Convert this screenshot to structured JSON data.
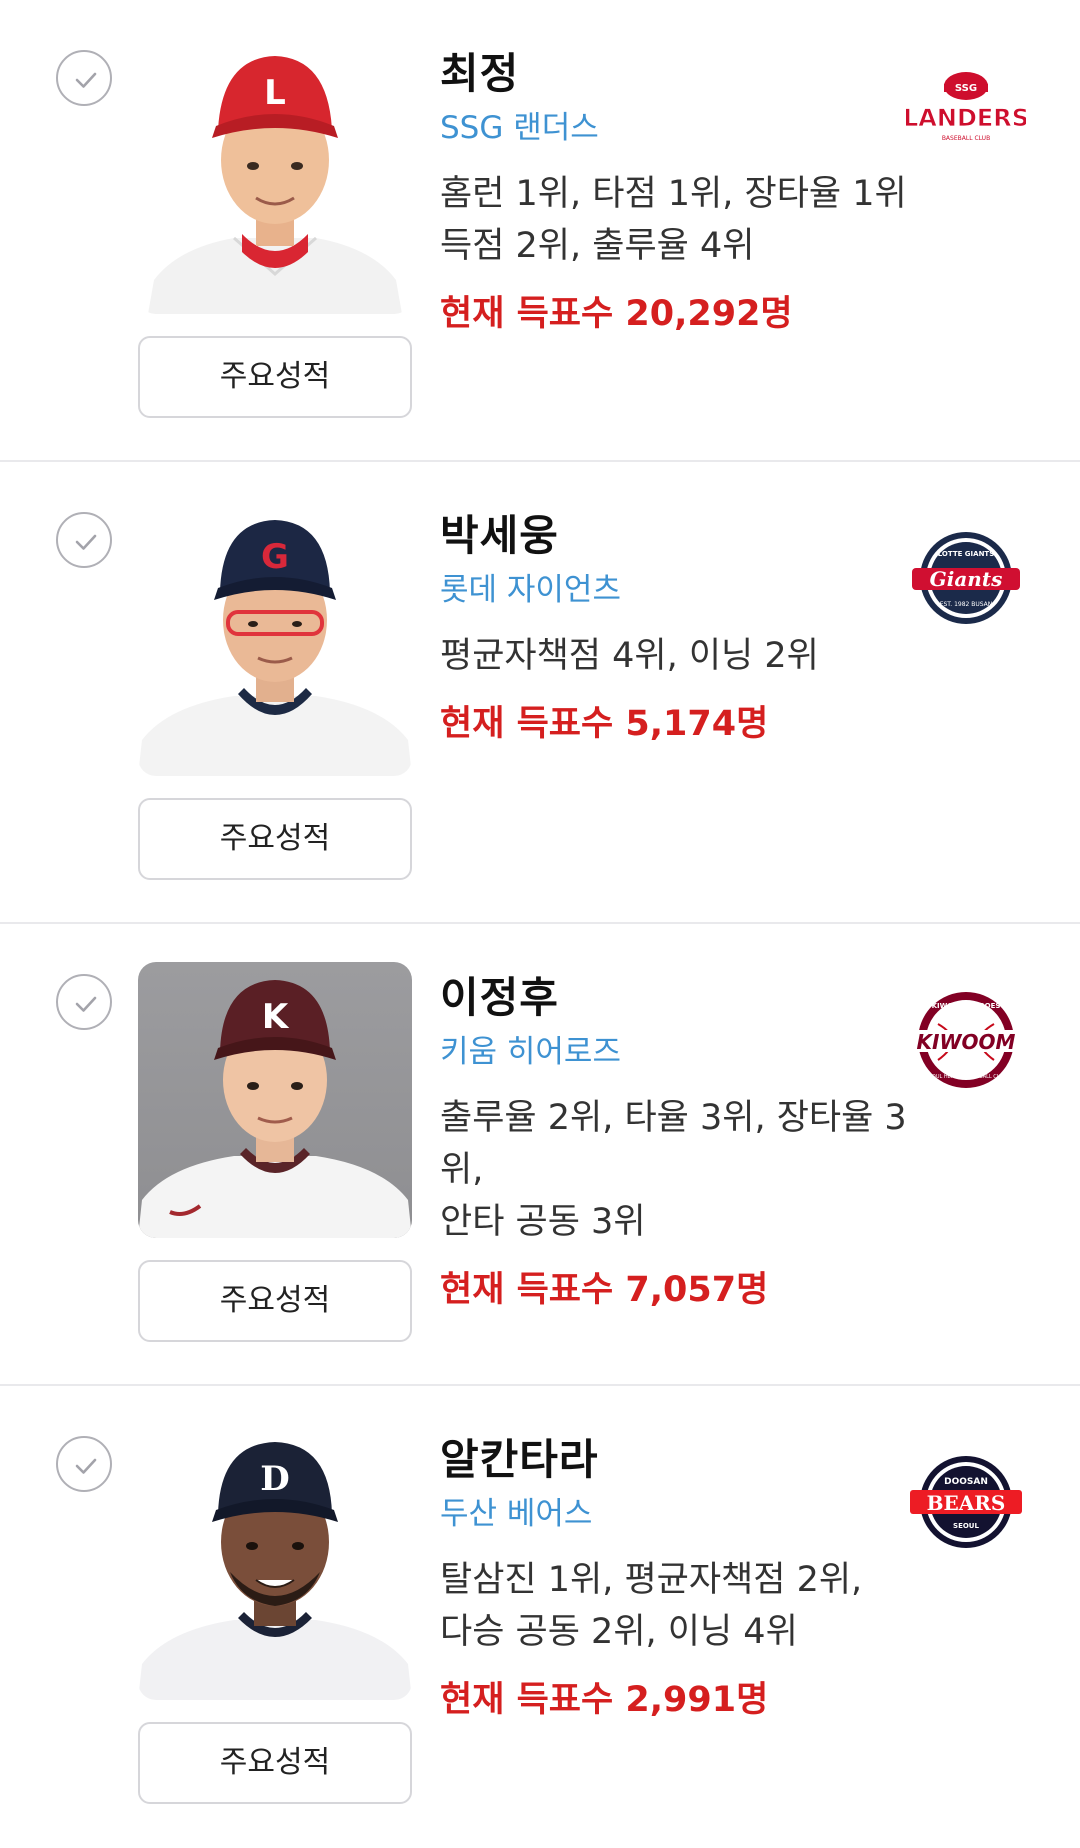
{
  "players": [
    {
      "name": "최정",
      "team": "SSG 랜더스",
      "records": "홈런 1위, 타점 1위, 장타율 1위\n득점 2위, 출루율 4위",
      "votes": "현재 득표수 20,292명",
      "stats_button": "주요성적",
      "logo": {
        "icon": "ssg-landers-logo",
        "top": "SSG",
        "main": "LANDERS",
        "sub": "BASEBALL CLUB",
        "color": "#ce0e2d"
      },
      "cap_color": "#d7262e",
      "cap_letter": "L"
    },
    {
      "name": "박세웅",
      "team": "롯데 자이언츠",
      "records": "평균자책점 4위, 이닝 2위",
      "votes": "현재 득표수 5,174명",
      "stats_button": "주요성적",
      "logo": {
        "icon": "lotte-giants-logo",
        "top": "LOTTE GIANTS",
        "main": "Giants",
        "sub": "EST. 1982 BUSAN",
        "color": "#d00f31"
      },
      "cap_color": "#1c2744",
      "cap_letter": "G"
    },
    {
      "name": "이정후",
      "team": "키움 히어로즈",
      "records": "출루율 2위, 타율 3위, 장타율 3위,\n안타 공동 3위",
      "votes": "현재 득표수 7,057명",
      "stats_button": "주요성적",
      "logo": {
        "icon": "kiwoom-heroes-logo",
        "top": "KIWOOM HEROES",
        "main": "KIWOOM",
        "sub": "SEOUL HEROES BASEBALL CLUB",
        "color": "#820024"
      },
      "cap_color": "#5a1f25",
      "cap_letter": "K"
    },
    {
      "name": "알칸타라",
      "team": "두산 베어스",
      "records": "탈삼진 1위, 평균자책점 2위,\n다승 공동 2위, 이닝 4위",
      "votes": "현재 득표수 2,991명",
      "stats_button": "주요성적",
      "logo": {
        "icon": "doosan-bears-logo",
        "top": "DOOSAN",
        "main": "BEARS",
        "sub": "SEOUL",
        "color": "#131230"
      },
      "cap_color": "#1b2236",
      "cap_letter": "D"
    }
  ],
  "colors": {
    "team": "#3e92d2",
    "votes": "#d51f1f",
    "divider": "#e9e9ec"
  }
}
